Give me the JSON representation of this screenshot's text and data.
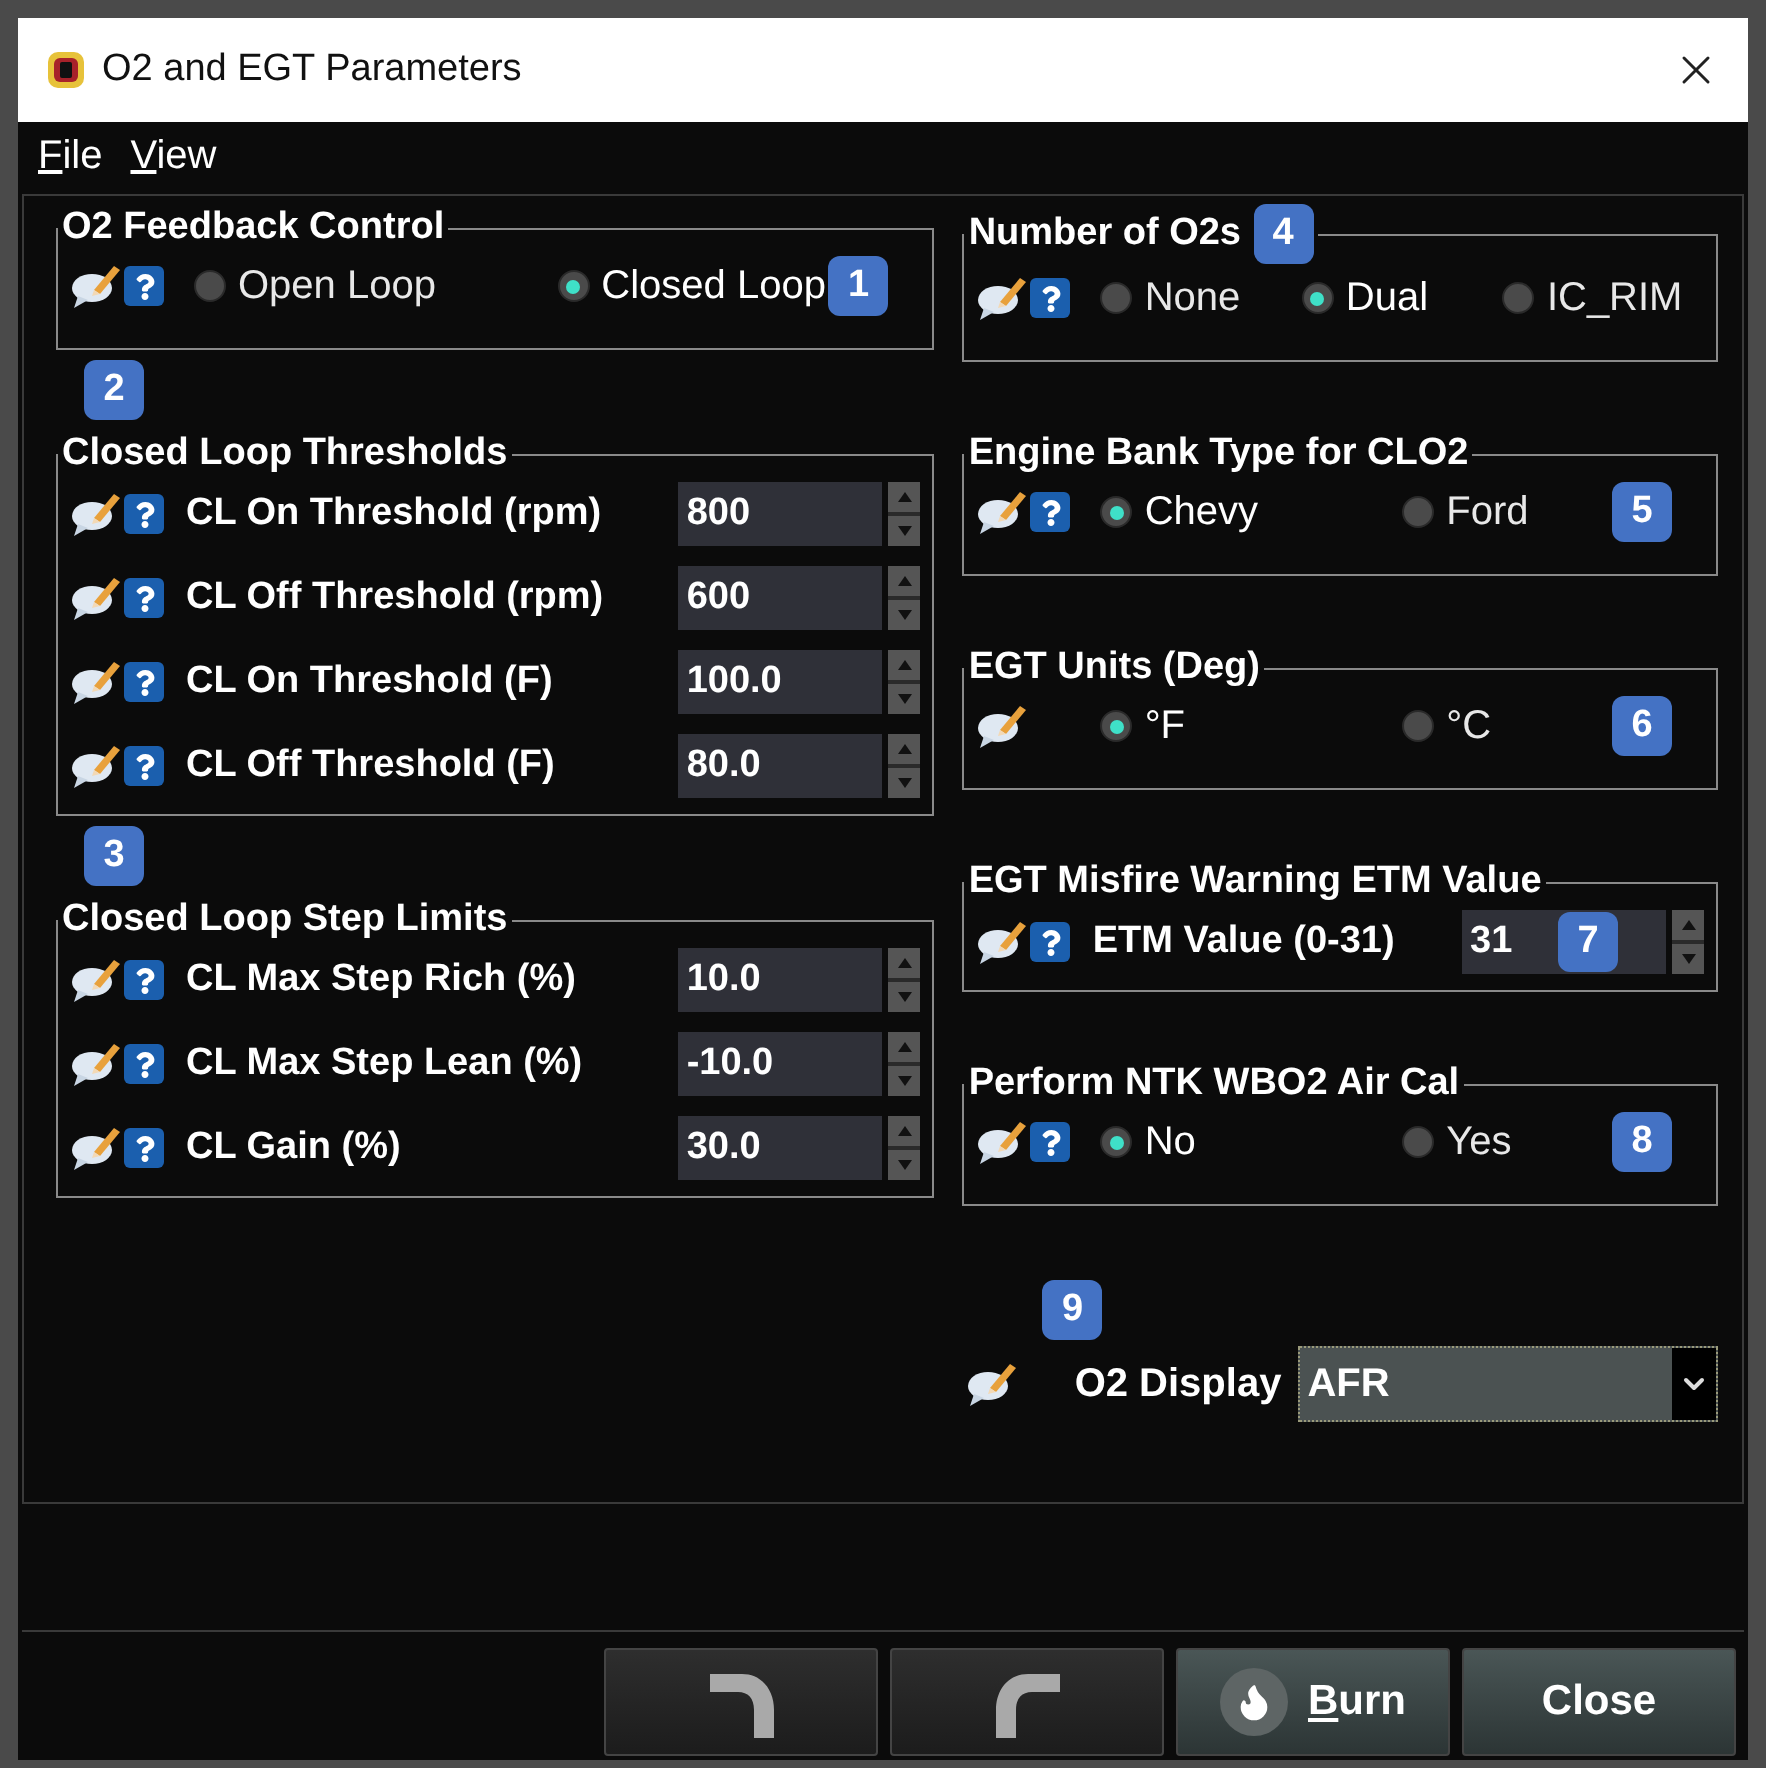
{
  "window": {
    "title": "O2 and EGT Parameters"
  },
  "menu": [
    {
      "label": "File"
    },
    {
      "label": "View"
    }
  ],
  "left_column": [
    {
      "kind": "radio",
      "title": "O2 Feedback Control",
      "help": true,
      "badge": {
        "text": "1",
        "kind": "inside"
      },
      "options": [
        {
          "label": "Open Loop",
          "selected": false
        },
        {
          "label": "Closed Loop",
          "selected": true
        }
      ]
    },
    {
      "kind": "fields",
      "title": "Closed Loop Thresholds",
      "badge": {
        "text": "2",
        "kind": "above"
      },
      "rows": [
        {
          "label": "CL On Threshold (rpm)",
          "value": "800"
        },
        {
          "label": "CL Off Threshold (rpm)",
          "value": "600"
        },
        {
          "label": "CL On Threshold (F)",
          "value": "100.0"
        },
        {
          "label": "CL Off Threshold (F)",
          "value": "80.0"
        }
      ]
    },
    {
      "kind": "fields",
      "title": "Closed Loop Step Limits",
      "badge": {
        "text": "3",
        "kind": "above"
      },
      "rows": [
        {
          "label": "CL Max Step Rich (%)",
          "value": "10.0"
        },
        {
          "label": "CL Max Step Lean (%)",
          "value": "-10.0"
        },
        {
          "label": "CL Gain (%)",
          "value": "30.0"
        }
      ]
    }
  ],
  "right_column": [
    {
      "kind": "radio",
      "title": "Number of O2s",
      "help": true,
      "badge": {
        "text": "4",
        "kind": "title"
      },
      "options": [
        {
          "label": "None",
          "selected": false
        },
        {
          "label": "Dual",
          "selected": true
        },
        {
          "label": "IC_RIM",
          "selected": false
        }
      ]
    },
    {
      "kind": "radio",
      "title": "Engine Bank Type for CLO2",
      "help": true,
      "badge": {
        "text": "5",
        "kind": "inside"
      },
      "options": [
        {
          "label": "Chevy",
          "selected": true
        },
        {
          "label": "Ford",
          "selected": false
        }
      ]
    },
    {
      "kind": "radio",
      "title": "EGT Units (Deg)",
      "help": false,
      "badge": {
        "text": "6",
        "kind": "inside"
      },
      "options": [
        {
          "label": "°F",
          "selected": true
        },
        {
          "label": "°C",
          "selected": false
        }
      ]
    },
    {
      "kind": "fields",
      "title": "EGT Misfire Warning ETM Value",
      "badge": {
        "text": "7",
        "kind": "field"
      },
      "rows": [
        {
          "label": "ETM Value (0-31)",
          "value": "31"
        }
      ]
    },
    {
      "kind": "radio",
      "title": "Perform NTK WBO2 Air Cal",
      "help": true,
      "badge": {
        "text": "8",
        "kind": "inside"
      },
      "options": [
        {
          "label": "No",
          "selected": true
        },
        {
          "label": "Yes",
          "selected": false
        }
      ]
    },
    {
      "kind": "select",
      "label": "O2 Display",
      "value": "AFR",
      "badge": {
        "text": "9",
        "kind": "above"
      }
    }
  ],
  "buttons": [
    {
      "kind": "undo"
    },
    {
      "kind": "redo"
    },
    {
      "kind": "burn",
      "label": "Burn"
    },
    {
      "kind": "close",
      "label": "Close"
    }
  ]
}
